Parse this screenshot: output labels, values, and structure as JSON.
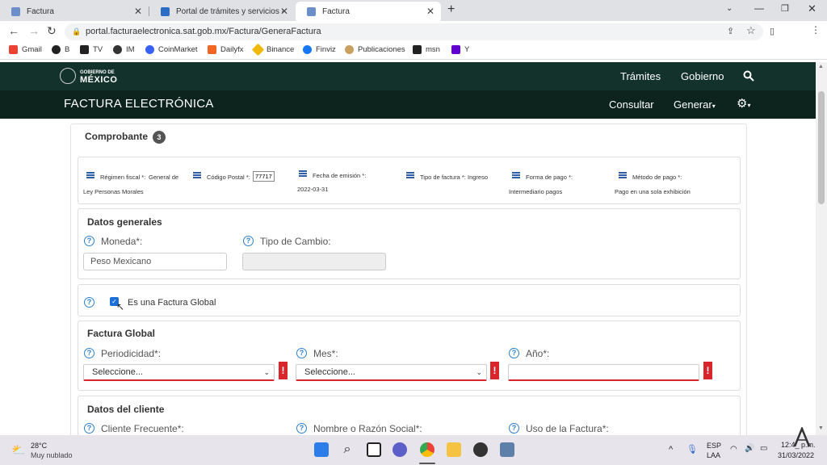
{
  "browser": {
    "tabs": [
      {
        "title": "Factura",
        "active": false
      },
      {
        "title": "Portal de trámites y servicios - SA",
        "active": false
      },
      {
        "title": "Factura",
        "active": true
      }
    ],
    "new_tab": "+",
    "url": "portal.facturaelectronica.sat.gob.mx/Factura/GeneraFactura",
    "bookmarks": [
      {
        "label": "Gmail",
        "color": "#ea4335"
      },
      {
        "label": "B",
        "color": "#222222"
      },
      {
        "label": "TV",
        "color": "#222222"
      },
      {
        "label": "IM",
        "color": "#333333"
      },
      {
        "label": "CoinMarket",
        "color": "#3861fb"
      },
      {
        "label": "Dailyfx",
        "color": "#f26522"
      },
      {
        "label": "Binance",
        "color": "#f0b90b"
      },
      {
        "label": "Finviz",
        "color": "#1877f2"
      },
      {
        "label": "Publicaciones",
        "color": "#c8a060"
      },
      {
        "label": "msn",
        "color": "#222222"
      },
      {
        "label": "Y",
        "color": "#6001d2"
      }
    ]
  },
  "gov": {
    "logo_line1": "GOBIERNO DE",
    "logo_line2": "MÉXICO",
    "nav_tramites": "Trámites",
    "nav_gobierno": "Gobierno",
    "search_icon": "search-icon",
    "bg_color": "#13322b"
  },
  "fe": {
    "title": "FACTURA ELECTRÓNICA",
    "consultar": "Consultar",
    "generar": "Generar",
    "gear_icon": "gear-icon"
  },
  "comprobante": {
    "title": "Comprobante",
    "badge": "3",
    "regimen_label": "Régimen fiscal *:",
    "regimen_value_a": "General de",
    "regimen_value_b": "Ley Personas Morales",
    "cp_label": "Código Postal *:",
    "cp_value": "77717",
    "fecha_label": "Fecha de emisión *:",
    "fecha_value": "2022-03-31",
    "tipo_label": "Tipo de factura *:",
    "tipo_value": "Ingreso",
    "forma_label": "Forma de pago *:",
    "forma_value": "Intermediario pagos",
    "metodo_label": "Método de pago *:",
    "metodo_value": "Pago en una sola exhibición"
  },
  "datos_generales": {
    "title": "Datos generales",
    "moneda_label": "Moneda*:",
    "moneda_value": "Peso Mexicano",
    "tipo_cambio_label": "Tipo de Cambio:",
    "tipo_cambio_value": ""
  },
  "factura_global_check": {
    "label": "Es una Factura Global",
    "checked": true
  },
  "factura_global": {
    "title": "Factura Global",
    "periodicidad_label": "Periodicidad*:",
    "periodicidad_value": "Seleccione...",
    "mes_label": "Mes*:",
    "mes_value": "Seleccione...",
    "anio_label": "Año*:",
    "anio_value": "",
    "error_mark": "!",
    "error_color": "#d9262c"
  },
  "datos_cliente": {
    "title": "Datos del cliente",
    "cliente_label": "Cliente Frecuente*:",
    "nombre_label": "Nombre o Razón Social*:",
    "uso_label": "Uso de la Factura*:"
  },
  "taskbar": {
    "weather_temp": "28°C",
    "weather_desc": "Muy nublado",
    "lang_1": "ESP",
    "lang_2": "LAA",
    "time": "12:4_ p.m.",
    "date": "31/03/2022"
  }
}
